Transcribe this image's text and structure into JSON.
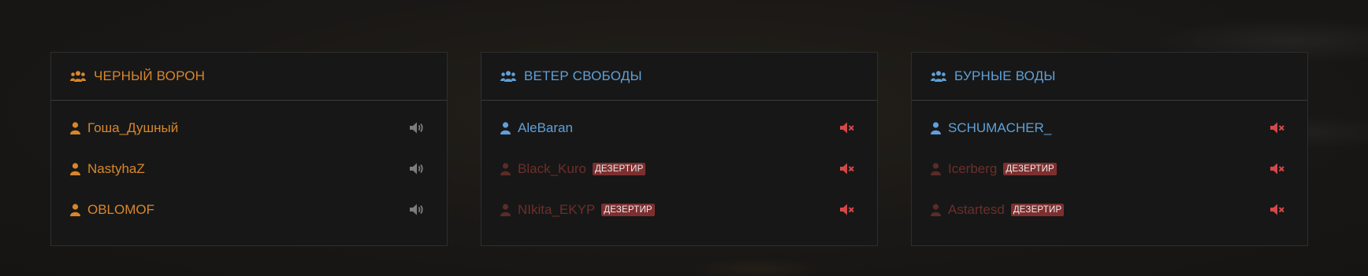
{
  "colors": {
    "orange": "#d8862c",
    "blue": "#5fa0d8",
    "deserter": "#6b2f2a",
    "muted_icon": "#7c7c7c",
    "mute_red": "#d4484a",
    "badge_bg": "#7d2f2f"
  },
  "teams": [
    {
      "name": "ЧЕРНЫЙ ВОРОН",
      "icon": "users-icon",
      "players": [
        {
          "name": "Гоша_Душный",
          "badge": "",
          "status": "active",
          "audio": "volume-icon"
        },
        {
          "name": "NastyhaZ",
          "badge": "",
          "status": "active",
          "audio": "volume-icon"
        },
        {
          "name": "OBLOMOF",
          "badge": "",
          "status": "active",
          "audio": "volume-icon"
        }
      ]
    },
    {
      "name": "ВЕТЕР СВОБОДЫ",
      "icon": "users-icon",
      "players": [
        {
          "name": "AleBaran",
          "badge": "",
          "status": "active",
          "audio": "mute-icon"
        },
        {
          "name": "Black_Kuro",
          "badge": "ДЕЗЕРТИР",
          "status": "deserter",
          "audio": "mute-icon"
        },
        {
          "name": "NIkita_EKYP",
          "badge": "ДЕЗЕРТИР",
          "status": "deserter",
          "audio": "mute-icon"
        }
      ]
    },
    {
      "name": "БУРНЫЕ ВОДЫ",
      "icon": "users-icon",
      "players": [
        {
          "name": "SCHUMACHER_",
          "badge": "",
          "status": "active",
          "audio": "mute-icon"
        },
        {
          "name": "Icerberg",
          "badge": "ДЕЗЕРТИР",
          "status": "deserter",
          "audio": "mute-icon"
        },
        {
          "name": "Astartesd",
          "badge": "ДЕЗЕРТИР",
          "status": "deserter",
          "audio": "mute-icon"
        }
      ]
    }
  ]
}
